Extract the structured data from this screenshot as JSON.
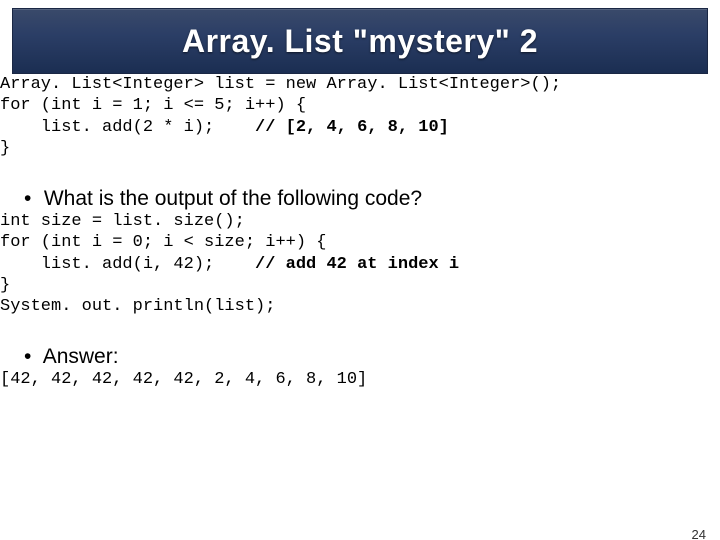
{
  "title": "Array. List \"mystery\" 2",
  "code1": {
    "l1a": "Array. List<Integer> list = new Array. List<Integer>();",
    "l2a": "for (int i = 1; i <= 5; i++) {",
    "l3a": "    list. add(2 * i);    ",
    "l3comment": "// [2, 4, 6, 8, 10]",
    "l4a": "}"
  },
  "question": "What is the output of the following code?",
  "code2": {
    "l1": "int size = list. size();",
    "l2": "for (int i = 0; i < size; i++) {",
    "l3": "    list. add(i, 42);    ",
    "l3comment": "// add 42 at index i",
    "l4": "}",
    "l5": "System. out. println(list);"
  },
  "answer_label": "Answer:",
  "answer_value": "[42, 42, 42, 42, 42, 2, 4, 6, 8, 10]",
  "page_number": "24"
}
